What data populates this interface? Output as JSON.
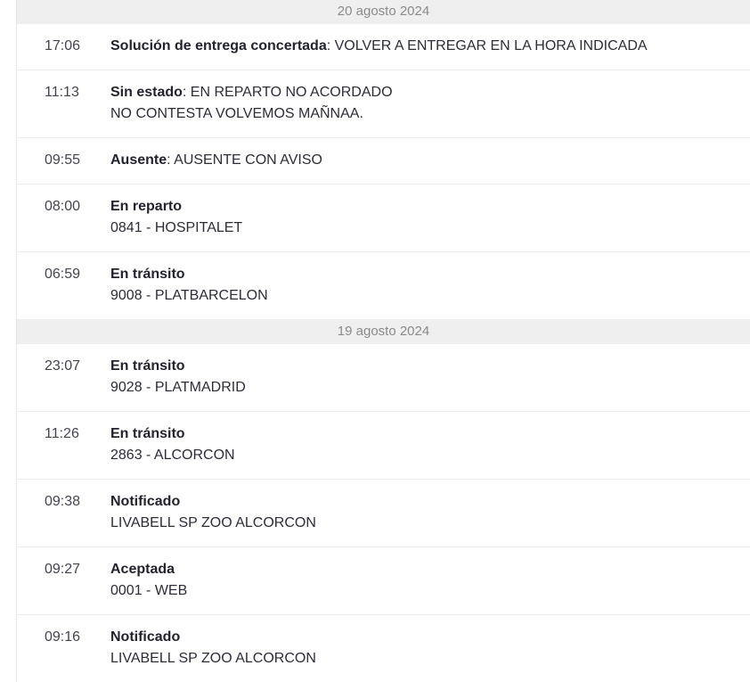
{
  "groups": [
    {
      "date": "20 agosto 2024",
      "events": [
        {
          "time": "17:06",
          "title": "Solución de entrega concertada",
          "sep": ": ",
          "detail": "VOLVER A ENTREGAR EN LA HORA INDICADA",
          "line2": ""
        },
        {
          "time": "11:13",
          "title": "Sin estado",
          "sep": ": ",
          "detail": "EN REPARTO NO ACORDADO",
          "line2": "NO CONTESTA VOLVEMOS MAÑNAA."
        },
        {
          "time": "09:55",
          "title": "Ausente",
          "sep": ": ",
          "detail": "AUSENTE CON AVISO",
          "line2": ""
        },
        {
          "time": "08:00",
          "title": "En reparto",
          "sep": "",
          "detail": "",
          "line2": "0841 - HOSPITALET"
        },
        {
          "time": "06:59",
          "title": "En tránsito",
          "sep": "",
          "detail": "",
          "line2": "9008 - PLATBARCELON"
        }
      ]
    },
    {
      "date": "19 agosto 2024",
      "events": [
        {
          "time": "23:07",
          "title": "En tránsito",
          "sep": "",
          "detail": "",
          "line2": "9028 - PLATMADRID"
        },
        {
          "time": "11:26",
          "title": "En tránsito",
          "sep": "",
          "detail": "",
          "line2": "2863 - ALCORCON"
        },
        {
          "time": "09:38",
          "title": "Notificado",
          "sep": "",
          "detail": "",
          "line2": "LIVABELL SP ZOO ALCORCON"
        },
        {
          "time": "09:27",
          "title": "Aceptada",
          "sep": "",
          "detail": "",
          "line2": "0001 - WEB"
        },
        {
          "time": "09:16",
          "title": "Notificado",
          "sep": "",
          "detail": "",
          "line2": "LIVABELL SP ZOO ALCORCON"
        }
      ]
    }
  ]
}
